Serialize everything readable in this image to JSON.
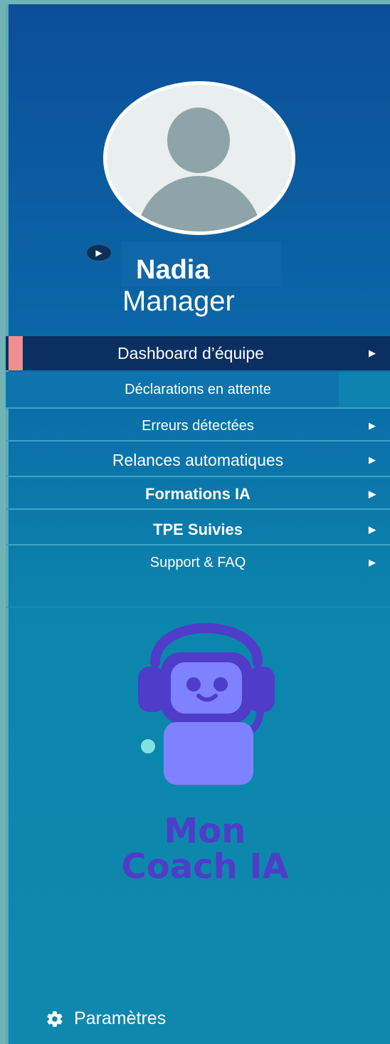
{
  "profile": {
    "name": "Nadia",
    "role": "Manager",
    "play_icon": "play-icon"
  },
  "nav": {
    "active": {
      "label": "Dashboard d’équipe",
      "arrow": "▶"
    },
    "sub": {
      "label": "Déclarations en attente"
    },
    "items": [
      {
        "label": "Erreurs détectées",
        "arrow": "▶"
      },
      {
        "label": "Relances automatiques",
        "arrow": "▶"
      },
      {
        "label": "Formations IA",
        "arrow": "▶"
      },
      {
        "label": "TPE Suivies",
        "arrow": "▶"
      },
      {
        "label": "Support & FAQ",
        "arrow": "▶"
      }
    ]
  },
  "logo": {
    "line1": "Mon",
    "line2": "Coach IA",
    "icon": "robot-headset-icon"
  },
  "settings": {
    "label": "Paramètres",
    "icon": "gear-icon"
  },
  "colors": {
    "accent": "#f08f8f",
    "active_bg": "#0b2f60",
    "logo_purple": "#4f3cc9",
    "logo_light": "#7e82ff",
    "logo_teal": "#7fe2e0"
  }
}
